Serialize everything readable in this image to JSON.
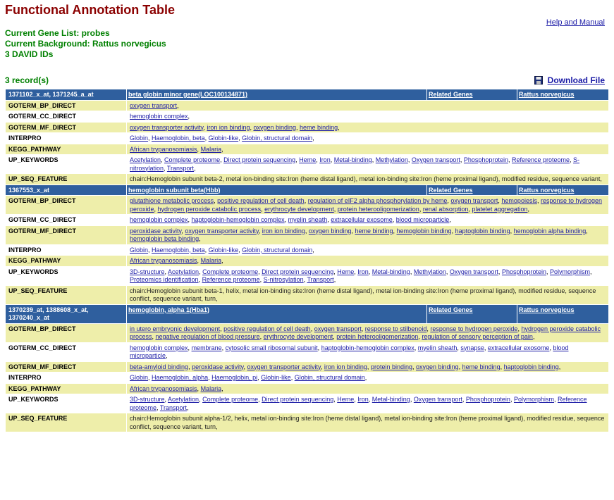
{
  "page": {
    "title": "Functional Annotation Table",
    "help_link": "Help and Manual",
    "gene_list": "Current Gene List: probes",
    "background": "Current Background: Rattus norvegicus",
    "david_ids": "3 DAVID IDs",
    "records": "3 record(s)",
    "download": "Download File"
  },
  "colors": {
    "title": "#8B0000",
    "info": "#008000",
    "header_bg": "#2f5f9e",
    "odd_row": "#eeeeaa",
    "link": "#1a1aa6"
  },
  "records": [
    {
      "ids": "1371102_x_at, 1371245_a_at",
      "gene": "beta globin minor gene(LOC100134871)",
      "related": "Related Genes",
      "species": "Rattus norvegicus",
      "rows": [
        {
          "category": "GOTERM_BP_DIRECT",
          "terms": [
            "oxygen transport"
          ]
        },
        {
          "category": "GOTERM_CC_DIRECT",
          "terms": [
            "hemoglobin complex"
          ]
        },
        {
          "category": "GOTERM_MF_DIRECT",
          "terms": [
            "oxygen transporter activity",
            "iron ion binding",
            "oxygen binding",
            "heme binding"
          ]
        },
        {
          "category": "INTERPRO",
          "terms": [
            "Globin",
            "Haemoglobin, beta",
            "Globin-like",
            "Globin, structural domain"
          ]
        },
        {
          "category": "KEGG_PATHWAY",
          "terms": [
            "African trypanosomiasis",
            "Malaria"
          ]
        },
        {
          "category": "UP_KEYWORDS",
          "terms": [
            "Acetylation",
            "Complete proteome",
            "Direct protein sequencing",
            "Heme",
            "Iron",
            "Metal-binding",
            "Methylation",
            "Oxygen transport",
            "Phosphoprotein",
            "Reference proteome",
            "S-nitrosylation",
            "Transport"
          ]
        },
        {
          "category": "UP_SEQ_FEATURE",
          "text": "chain:Hemoglobin subunit beta-2, metal ion-binding site:Iron (heme distal ligand), metal ion-binding site:Iron (heme proximal ligand), modified residue, sequence variant,"
        }
      ]
    },
    {
      "ids": "1367553_x_at",
      "gene": "hemoglobin subunit beta(Hbb)",
      "related": "Related Genes",
      "species": "Rattus norvegicus",
      "rows": [
        {
          "category": "GOTERM_BP_DIRECT",
          "terms": [
            "glutathione metabolic process",
            "positive regulation of cell death",
            "regulation of eIF2 alpha phosphorylation by heme",
            "oxygen transport",
            "hemopoiesis",
            "response to hydrogen peroxide",
            "hydrogen peroxide catabolic process",
            "erythrocyte development",
            "protein heterooligomerization",
            "renal absorption",
            "platelet aggregation"
          ]
        },
        {
          "category": "GOTERM_CC_DIRECT",
          "terms": [
            "hemoglobin complex",
            "haptoglobin-hemoglobin complex",
            "myelin sheath",
            "extracellular exosome",
            "blood microparticle"
          ]
        },
        {
          "category": "GOTERM_MF_DIRECT",
          "terms": [
            "peroxidase activity",
            "oxygen transporter activity",
            "iron ion binding",
            "oxygen binding",
            "heme binding",
            "hemoglobin binding",
            "haptoglobin binding",
            "hemoglobin alpha binding",
            "hemoglobin beta binding"
          ]
        },
        {
          "category": "INTERPRO",
          "terms": [
            "Globin",
            "Haemoglobin, beta",
            "Globin-like",
            "Globin, structural domain"
          ]
        },
        {
          "category": "KEGG_PATHWAY",
          "terms": [
            "African trypanosomiasis",
            "Malaria"
          ]
        },
        {
          "category": "UP_KEYWORDS",
          "terms": [
            "3D-structure",
            "Acetylation",
            "Complete proteome",
            "Direct protein sequencing",
            "Heme",
            "Iron",
            "Metal-binding",
            "Methylation",
            "Oxygen transport",
            "Phosphoprotein",
            "Polymorphism",
            "Proteomics identification",
            "Reference proteome",
            "S-nitrosylation",
            "Transport"
          ]
        },
        {
          "category": "UP_SEQ_FEATURE",
          "text": "chain:Hemoglobin subunit beta-1, helix, metal ion-binding site:Iron (heme distal ligand), metal ion-binding site:Iron (heme proximal ligand), modified residue, sequence conflict, sequence variant, turn,"
        }
      ]
    },
    {
      "ids": "1370239_at, 1388608_x_at, 1370240_x_at",
      "gene": "hemoglobin, alpha 1(Hba1)",
      "related": "Related Genes",
      "species": "Rattus norvegicus",
      "rows": [
        {
          "category": "GOTERM_BP_DIRECT",
          "terms": [
            "in utero embryonic development",
            "positive regulation of cell death",
            "oxygen transport",
            "response to stilbenoid",
            "response to hydrogen peroxide",
            "hydrogen peroxide catabolic process",
            "negative regulation of blood pressure",
            "erythrocyte development",
            "protein heterooligomerization",
            "regulation of sensory perception of pain"
          ]
        },
        {
          "category": "GOTERM_CC_DIRECT",
          "terms": [
            "hemoglobin complex",
            "membrane",
            "cytosolic small ribosomal subunit",
            "haptoglobin-hemoglobin complex",
            "myelin sheath",
            "synapse",
            "extracellular exosome",
            "blood microparticle"
          ]
        },
        {
          "category": "GOTERM_MF_DIRECT",
          "terms": [
            "beta-amyloid binding",
            "peroxidase activity",
            "oxygen transporter activity",
            "iron ion binding",
            "protein binding",
            "oxygen binding",
            "heme binding",
            "haptoglobin binding"
          ]
        },
        {
          "category": "INTERPRO",
          "terms": [
            "Globin",
            "Haemoglobin, alpha",
            "Haemoglobin, pi",
            "Globin-like",
            "Globin, structural domain"
          ]
        },
        {
          "category": "KEGG_PATHWAY",
          "terms": [
            "African trypanosomiasis",
            "Malaria"
          ]
        },
        {
          "category": "UP_KEYWORDS",
          "terms": [
            "3D-structure",
            "Acetylation",
            "Complete proteome",
            "Direct protein sequencing",
            "Heme",
            "Iron",
            "Metal-binding",
            "Oxygen transport",
            "Phosphoprotein",
            "Polymorphism",
            "Reference proteome",
            "Transport"
          ]
        },
        {
          "category": "UP_SEQ_FEATURE",
          "text": "chain:Hemoglobin subunit alpha-1/2, helix, metal ion-binding site:Iron (heme distal ligand), metal ion-binding site:Iron (heme proximal ligand), modified residue, sequence conflict, sequence variant, turn,"
        }
      ]
    }
  ]
}
